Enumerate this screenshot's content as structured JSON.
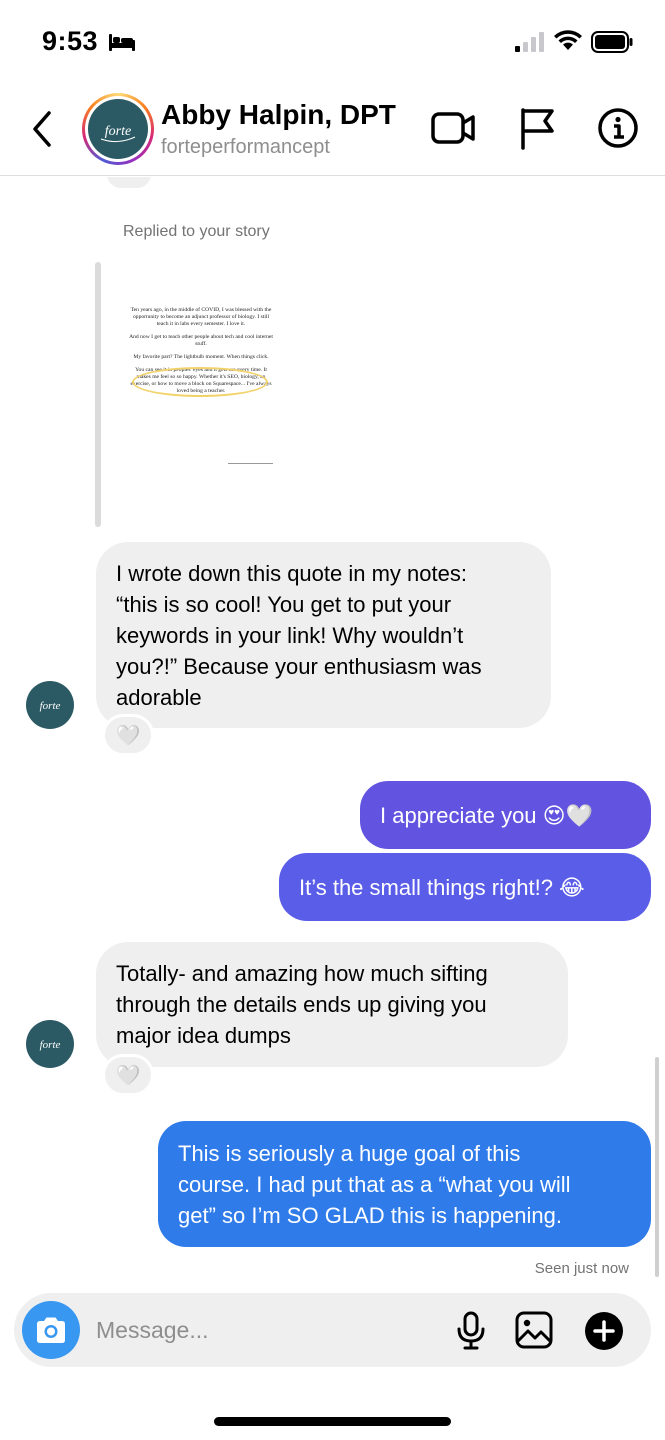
{
  "status_bar": {
    "time": "9:53",
    "icons": [
      "bed-icon",
      "signal-icon",
      "wifi-icon",
      "battery-icon"
    ]
  },
  "header": {
    "name": "Abby Halpin, DPT",
    "handle": "forteperformancept",
    "avatar_logo_text": "forte",
    "icons": [
      "back-icon",
      "video-camera-icon",
      "flag-icon",
      "info-icon"
    ]
  },
  "story_reply": {
    "label": "Replied to your story",
    "preview_paragraphs": [
      "Ten years ago, in the middle of COVID, I was blessed with the opportunity to become an adjunct professor of biology. I still teach it in labs every semester. I love it.",
      "And now I get to teach other people about tech and cool internet stuff.",
      "My favorite part? The lightbulb moment. When things click.",
      "You can see it in peoples' eyes and it gets me every time. It makes me feel so so happy. Whether it's SEO, biology, an exercise, or how to move a block on Squarespace... I've always loved being a teacher."
    ]
  },
  "messages": [
    {
      "direction": "incoming",
      "text": "I wrote down this quote in my notes:\n“this is so cool! You get to put your\nkeywords in your link! Why wouldn’t\nyou?!” Because your enthusiasm was\nadorable",
      "reaction": "🤍"
    },
    {
      "direction": "outgoing",
      "text": "I appreciate you 😍🤍",
      "color": "#6254e0"
    },
    {
      "direction": "outgoing",
      "text": "It’s the small things right!? 😂",
      "color": "#5a5de8"
    },
    {
      "direction": "incoming",
      "text": "Totally- and amazing how much sifting\nthrough the details ends up giving you\nmajor idea dumps",
      "reaction": "🤍"
    },
    {
      "direction": "outgoing",
      "text": "This is seriously a huge goal of this\ncourse. I had put that as a “what you will\nget” so I’m SO GLAD this is happening.",
      "color": "#2f7bea"
    }
  ],
  "seen_status": "Seen just now",
  "composer": {
    "placeholder": "Message...",
    "value": "",
    "icons": [
      "camera-icon",
      "microphone-icon",
      "image-icon",
      "plus-icon"
    ]
  },
  "colors": {
    "incoming_bubble": "#efefef",
    "camera_button": "#3897f0",
    "avatar_bg": "#2c5a64"
  }
}
